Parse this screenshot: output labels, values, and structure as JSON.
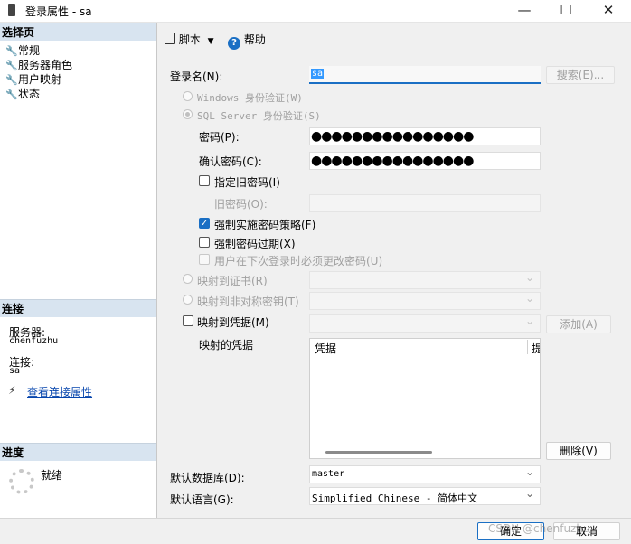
{
  "window": {
    "title": "登录属性 - sa",
    "minimize": "—",
    "maximize": "☐",
    "close": "✕"
  },
  "left": {
    "select_page_header": "选择页",
    "pages": [
      "常规",
      "服务器角色",
      "用户映射",
      "状态"
    ],
    "connection_header": "连接",
    "server_label": "服务器:",
    "server_value": "chenfuzhu",
    "connection_label": "连接:",
    "connection_value": "sa",
    "view_conn_props": "查看连接属性",
    "progress_header": "进度",
    "progress_status": "就绪"
  },
  "toolbar": {
    "script_label": "脚本",
    "help_label": "帮助"
  },
  "form": {
    "login_name_label": "登录名(N):",
    "login_name_value": "sa",
    "search_button": "搜索(E)...",
    "windows_auth": "Windows 身份验证(W)",
    "sql_auth": "SQL Server 身份验证(S)",
    "password_label": "密码(P):",
    "password_value": "●●●●●●●●●●●●●●●●",
    "confirm_label": "确认密码(C):",
    "confirm_value": "●●●●●●●●●●●●●●●●",
    "specify_old": "指定旧密码(I)",
    "old_password_label": "旧密码(O):",
    "enforce_policy": "强制实施密码策略(F)",
    "enforce_expiration": "强制密码过期(X)",
    "must_change": "用户在下次登录时必须更改密码(U)",
    "map_cert": "映射到证书(R)",
    "map_asym": "映射到非对称密钥(T)",
    "map_cred": "映射到凭据(M)",
    "add_button": "添加(A)",
    "mapped_creds_label": "映射的凭据",
    "cred_col1": "凭据",
    "cred_col2": "提",
    "delete_button": "删除(V)",
    "default_db_label": "默认数据库(D):",
    "default_db_value": "master",
    "default_lang_label": "默认语言(G):",
    "default_lang_value": "Simplified Chinese - 简体中文"
  },
  "footer": {
    "ok": "确定",
    "cancel": "取消",
    "watermark": "CSDN @chenfuzhu_"
  }
}
